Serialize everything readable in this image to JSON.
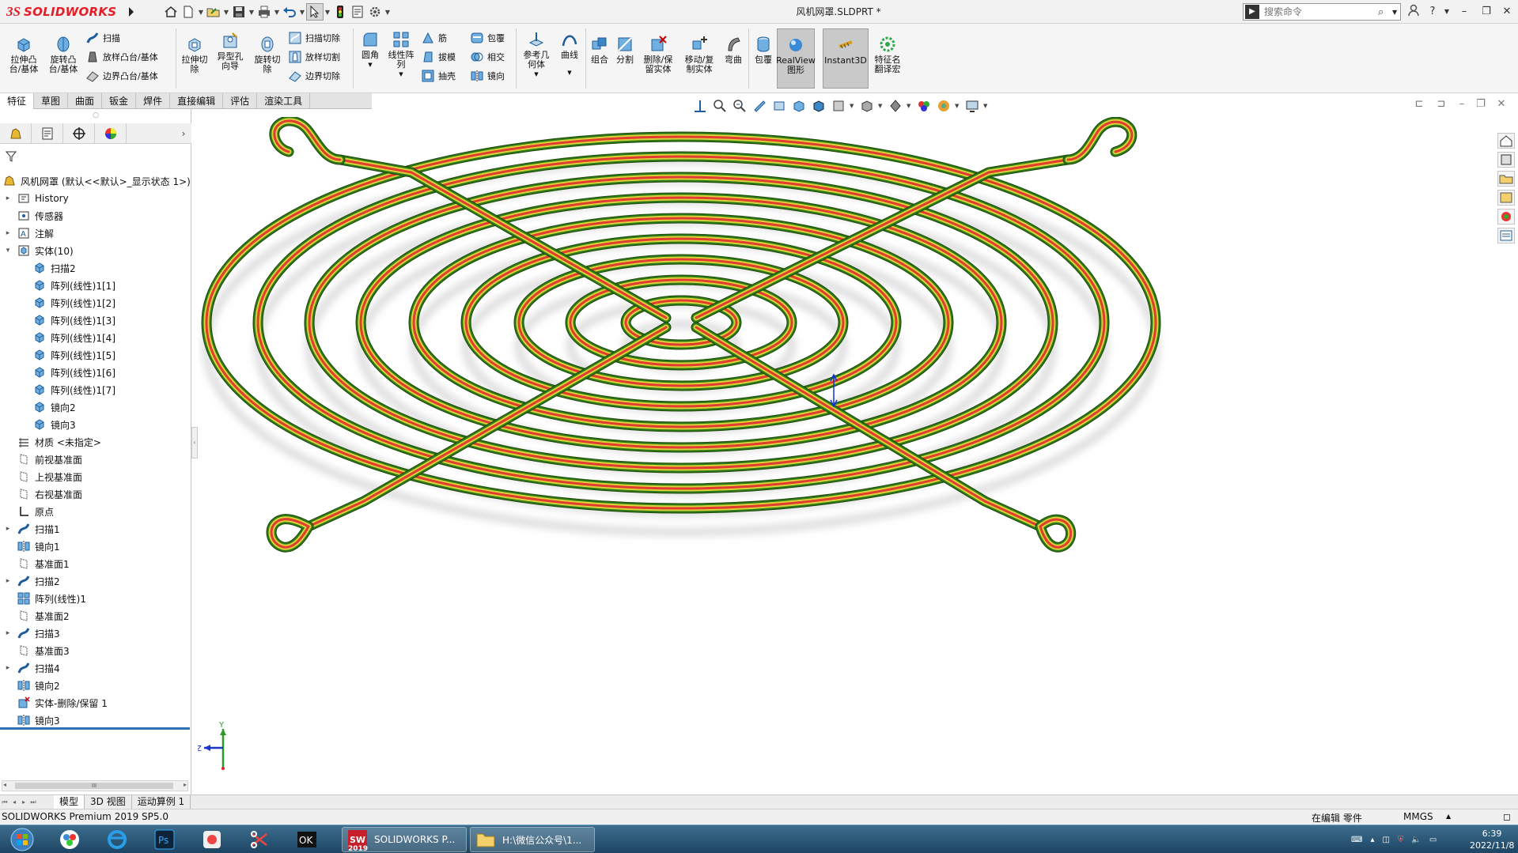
{
  "app": {
    "name": "SOLIDWORKS",
    "ds_mark": "3S",
    "document_title": "风机网罩.SLDPRT *",
    "search_placeholder": "搜索命令",
    "help_label": "?",
    "version": "SOLIDWORKS Premium 2019 SP5.0"
  },
  "colors": {
    "accent_red": "#e41e26",
    "selection_blue": "#2d6fb3",
    "wire_red": "#e23c2f",
    "wire_yellow": "#d9d23a",
    "wire_green": "#2e7a16"
  },
  "quick_access": [
    "home-icon",
    "new-icon",
    "open-icon",
    "save-icon",
    "print-icon",
    "undo-icon",
    "select-icon",
    "traffic-light-icon",
    "options-icon"
  ],
  "command_manager": {
    "large_tools": [
      {
        "id": "extrude-boss",
        "label": "拉伸凸\n台/基体"
      },
      {
        "id": "revolve-boss",
        "label": "旋转凸\n台/基体"
      },
      {
        "id": "extrude-cut",
        "label": "拉伸切\n除"
      },
      {
        "id": "hole-wizard",
        "label": "异型孔\n向导"
      },
      {
        "id": "revolve-cut",
        "label": "旋转切\n除"
      },
      {
        "id": "fillet",
        "label": "圆角"
      },
      {
        "id": "linear-pattern",
        "label": "线性阵\n列"
      },
      {
        "id": "ref-geometry",
        "label": "参考几\n何体"
      },
      {
        "id": "curves",
        "label": "曲线"
      },
      {
        "id": "combine",
        "label": "组合"
      },
      {
        "id": "split",
        "label": "分割"
      },
      {
        "id": "delete-body",
        "label": "删除/保\n留实体"
      },
      {
        "id": "move-copy",
        "label": "移动/复\n制实体"
      },
      {
        "id": "flex",
        "label": "弯曲"
      },
      {
        "id": "wrap",
        "label": "包覆"
      },
      {
        "id": "realview",
        "label": "RealView\n图形"
      },
      {
        "id": "instant3d",
        "label": "Instant3D"
      },
      {
        "id": "feature-translator",
        "label": "特征名\n翻译宏"
      }
    ],
    "small_tools": [
      {
        "id": "sweep",
        "label": "扫描"
      },
      {
        "id": "loft",
        "label": "放样凸台/基体"
      },
      {
        "id": "boundary",
        "label": "边界凸台/基体"
      },
      {
        "id": "sweep-cut",
        "label": "扫描切除"
      },
      {
        "id": "loft-cut",
        "label": "放样切割"
      },
      {
        "id": "boundary-cut",
        "label": "边界切除"
      },
      {
        "id": "rib",
        "label": "筋"
      },
      {
        "id": "draft",
        "label": "拔模"
      },
      {
        "id": "shell",
        "label": "抽壳"
      },
      {
        "id": "wrap-s",
        "label": "包覆"
      },
      {
        "id": "intersect",
        "label": "相交"
      },
      {
        "id": "mirror",
        "label": "镜向"
      }
    ]
  },
  "tabs": [
    "特征",
    "草图",
    "曲面",
    "钣金",
    "焊件",
    "直接编辑",
    "评估",
    "渲染工具"
  ],
  "feature_tree": {
    "root": "风机网罩  (默认<<默认>_显示状态 1>)",
    "items": [
      {
        "label": "History",
        "level": 1,
        "toggle": "▸",
        "icon": "history-icon"
      },
      {
        "label": "传感器",
        "level": 1,
        "toggle": "",
        "icon": "sensor-icon"
      },
      {
        "label": "注解",
        "level": 1,
        "toggle": "▸",
        "icon": "annotation-icon"
      },
      {
        "label": "实体(10)",
        "level": 1,
        "toggle": "▾",
        "icon": "solid-bodies-icon"
      },
      {
        "label": "扫描2",
        "level": 2,
        "toggle": "",
        "icon": "body-icon"
      },
      {
        "label": "阵列(线性)1[1]",
        "level": 2,
        "toggle": "",
        "icon": "body-icon"
      },
      {
        "label": "阵列(线性)1[2]",
        "level": 2,
        "toggle": "",
        "icon": "body-icon"
      },
      {
        "label": "阵列(线性)1[3]",
        "level": 2,
        "toggle": "",
        "icon": "body-icon"
      },
      {
        "label": "阵列(线性)1[4]",
        "level": 2,
        "toggle": "",
        "icon": "body-icon"
      },
      {
        "label": "阵列(线性)1[5]",
        "level": 2,
        "toggle": "",
        "icon": "body-icon"
      },
      {
        "label": "阵列(线性)1[6]",
        "level": 2,
        "toggle": "",
        "icon": "body-icon"
      },
      {
        "label": "阵列(线性)1[7]",
        "level": 2,
        "toggle": "",
        "icon": "body-icon"
      },
      {
        "label": "镜向2",
        "level": 2,
        "toggle": "",
        "icon": "body-icon"
      },
      {
        "label": "镜向3",
        "level": 2,
        "toggle": "",
        "icon": "body-icon"
      },
      {
        "label": "材质 <未指定>",
        "level": 1,
        "toggle": "",
        "icon": "material-icon"
      },
      {
        "label": "前视基准面",
        "level": 1,
        "toggle": "",
        "icon": "plane-icon"
      },
      {
        "label": "上视基准面",
        "level": 1,
        "toggle": "",
        "icon": "plane-icon"
      },
      {
        "label": "右视基准面",
        "level": 1,
        "toggle": "",
        "icon": "plane-icon"
      },
      {
        "label": "原点",
        "level": 1,
        "toggle": "",
        "icon": "origin-icon"
      },
      {
        "label": "扫描1",
        "level": 1,
        "toggle": "▸",
        "icon": "sweep-icon"
      },
      {
        "label": "镜向1",
        "level": 1,
        "toggle": "",
        "icon": "mirror-icon"
      },
      {
        "label": "基准面1",
        "level": 1,
        "toggle": "",
        "icon": "plane-icon"
      },
      {
        "label": "扫描2",
        "level": 1,
        "toggle": "▸",
        "icon": "sweep-icon"
      },
      {
        "label": "阵列(线性)1",
        "level": 1,
        "toggle": "",
        "icon": "pattern-icon"
      },
      {
        "label": "基准面2",
        "level": 1,
        "toggle": "",
        "icon": "plane-icon"
      },
      {
        "label": "扫描3",
        "level": 1,
        "toggle": "▸",
        "icon": "sweep-icon"
      },
      {
        "label": "基准面3",
        "level": 1,
        "toggle": "",
        "icon": "plane-icon"
      },
      {
        "label": "扫描4",
        "level": 1,
        "toggle": "▸",
        "icon": "sweep-icon"
      },
      {
        "label": "镜向2",
        "level": 1,
        "toggle": "",
        "icon": "mirror-icon"
      },
      {
        "label": "实体-删除/保留 1",
        "level": 1,
        "toggle": "",
        "icon": "body-delete-icon"
      },
      {
        "label": "镜向3",
        "level": 1,
        "toggle": "",
        "icon": "mirror-icon"
      }
    ]
  },
  "scroll_label": "III",
  "triad": {
    "y_label": "Y",
    "z_label": "Z"
  },
  "bottom_tabs": [
    "模型",
    "3D 视图",
    "运动算例 1"
  ],
  "status": {
    "left": "SOLIDWORKS Premium 2019 SP5.0",
    "edit_state": "在编辑 零件",
    "units": "MMGS"
  },
  "taskbar": {
    "tasks": [
      {
        "label": "SOLIDWORKS P..."
      },
      {
        "label": "H:\\微信公众号\\1..."
      }
    ],
    "time": "6:39",
    "date": "2022/11/8"
  },
  "sw_badge": "2019"
}
